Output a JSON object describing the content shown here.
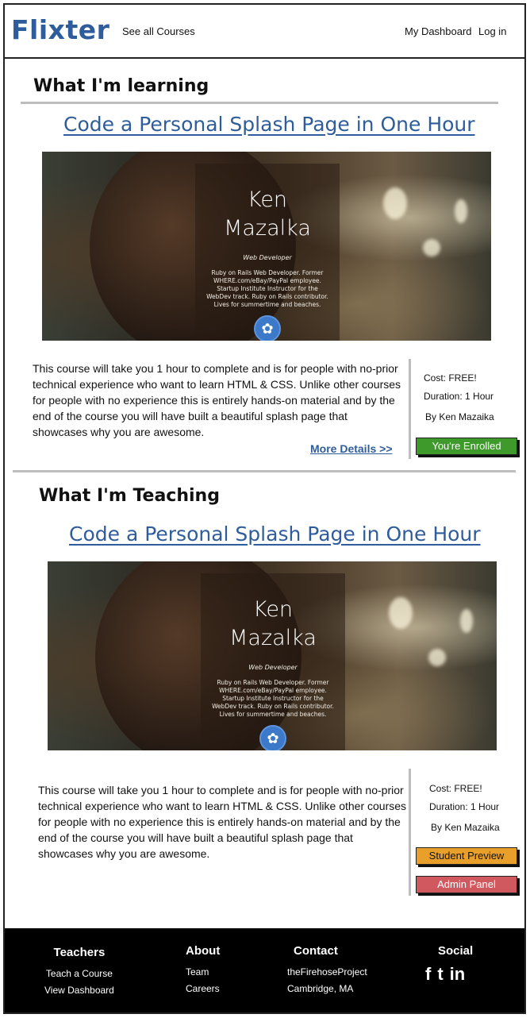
{
  "header": {
    "logo": "Flixter",
    "nav_all_courses": "See all Courses",
    "nav_dashboard": "My Dashboard",
    "nav_login": "Log in"
  },
  "learning": {
    "heading": "What I'm learning",
    "course_title": "Code a Personal Splash Page in One Hour",
    "banner": {
      "name_line1": "Ken",
      "name_line2": "Mazalka",
      "role": "Web Developer",
      "bio": "Ruby on Rails Web Developer. Former WHERE.com/eBay/PayPal employee. Startup Institute Instructor for the WebDev track. Ruby on Rails contributor. Lives for summertime and beaches."
    },
    "description": "This course will take you 1 hour to complete and is for people with no-prior technical experience who want to learn HTML & CSS. Unlike other courses for people with no experience this is entirely hands-on material and by the end of the course you will have built a beautiful splash page that showcases why you are awesome.",
    "more_details": "More Details >>",
    "cost": "Cost: FREE!",
    "duration": "Duration: 1 Hour",
    "author": "By Ken Mazaika",
    "enrolled_label": "You're Enrolled"
  },
  "teaching": {
    "heading": "What I'm Teaching",
    "course_title": "Code a Personal Splash Page in One Hour",
    "banner": {
      "name_line1": "Ken",
      "name_line2": "Mazalka",
      "role": "Web Developer",
      "bio": "Ruby on Rails Web Developer. Former WHERE.com/eBay/PayPal employee. Startup Institute Instructor for the WebDev track. Ruby on Rails contributor. Lives for summertime and beaches."
    },
    "description": "This course will take you 1 hour to complete and is for people with no-prior technical experience who want to learn HTML & CSS. Unlike other courses for people with no experience this is entirely hands-on material and by the end of the course you will have built a beautiful splash page that showcases why you are awesome.",
    "cost": "Cost: FREE!",
    "duration": "Duration: 1 Hour",
    "author": "By Ken Mazaika",
    "preview_label": "Student Preview",
    "admin_label": "Admin Panel"
  },
  "footer": {
    "teachers": {
      "heading": "Teachers",
      "links": [
        "Teach a Course",
        "View Dashboard"
      ]
    },
    "about": {
      "heading": "About",
      "links": [
        "Team",
        "Careers"
      ]
    },
    "contact": {
      "heading": "Contact",
      "lines": [
        "theFirehoseProject",
        "Cambridge, MA"
      ]
    },
    "social": {
      "heading": "Social",
      "icons": [
        "f",
        "t",
        "in"
      ]
    }
  },
  "colors": {
    "brand": "#2f5d9b",
    "enrolled_green": "#3f9a2c",
    "preview_orange": "#e8a02b",
    "admin_red": "#d0595f"
  }
}
